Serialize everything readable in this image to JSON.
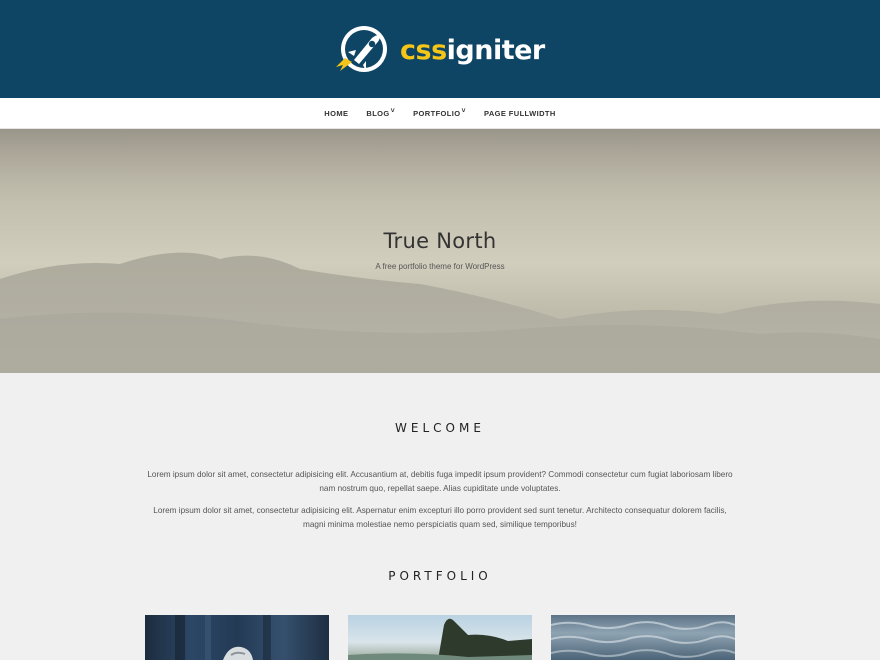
{
  "brand": {
    "name_part1": "css",
    "name_part2": "igniter",
    "colors": {
      "header_bg": "#0e4564",
      "accent": "#f5c518"
    },
    "icon": "rocket-logo-icon"
  },
  "nav": {
    "items": [
      {
        "label": "HOME",
        "has_dropdown": false
      },
      {
        "label": "BLOG",
        "has_dropdown": true
      },
      {
        "label": "PORTFOLIO",
        "has_dropdown": true
      },
      {
        "label": "PAGE FULLWIDTH",
        "has_dropdown": false
      }
    ]
  },
  "hero": {
    "title": "True North",
    "subtitle": "A free portfolio theme for WordPress"
  },
  "welcome": {
    "heading": "WELCOME",
    "paragraph1": "Lorem ipsum dolor sit amet, consectetur adipisicing elit. Accusantium at, debitis fuga impedit ipsum provident? Commodi consectetur cum fugiat laboriosam libero nam nostrum quo, repellat saepe. Alias cupiditate unde voluptates.",
    "paragraph2": "Lorem ipsum dolor sit amet, consectetur adipisicing elit. Aspernatur enim excepturi illo porro provident sed sunt tenetur. Architecto consequatur dolorem facilis, magni minima molestiae nemo perspiciatis quam sed, similique temporibus!"
  },
  "portfolio": {
    "heading": "PORTFOLIO",
    "items": [
      {
        "thumb": "dark-blue-wood-with-object"
      },
      {
        "thumb": "sky-and-treeline"
      },
      {
        "thumb": "ocean-waves"
      }
    ]
  }
}
